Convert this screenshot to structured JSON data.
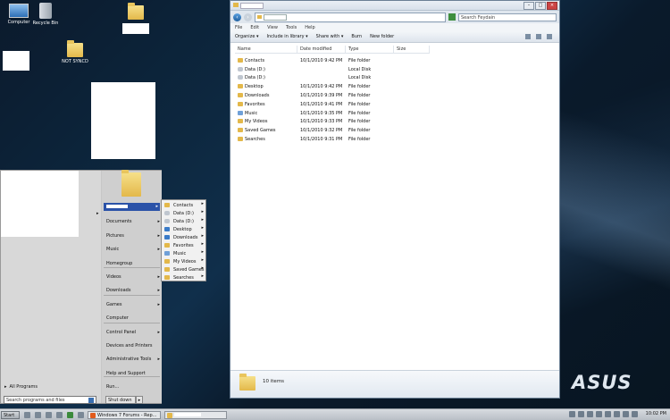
{
  "desktop": {
    "icons": [
      {
        "label": "Computer"
      },
      {
        "label": "Recycle Bin"
      },
      {
        "label": "NOT SYNCD"
      }
    ]
  },
  "explorer": {
    "search_placeholder": "Search Feydain",
    "menu": [
      "File",
      "Edit",
      "View",
      "Tools",
      "Help"
    ],
    "commands": [
      "Organize",
      "Include in library",
      "Share with",
      "Burn",
      "New folder"
    ],
    "columns": [
      "Name",
      "Date modified",
      "Type",
      "Size"
    ],
    "rows": [
      {
        "name": "Contacts",
        "date": "10/1/2010 9:42 PM",
        "type": "File folder",
        "icon": "folder"
      },
      {
        "name": "Data (D:)",
        "date": "",
        "type": "Local Disk",
        "icon": "disk"
      },
      {
        "name": "Data (D:)",
        "date": "",
        "type": "Local Disk",
        "icon": "disk"
      },
      {
        "name": "Desktop",
        "date": "10/1/2010 9:42 PM",
        "type": "File folder",
        "icon": "folder"
      },
      {
        "name": "Downloads",
        "date": "10/1/2010 9:39 PM",
        "type": "File folder",
        "icon": "folder"
      },
      {
        "name": "Favorites",
        "date": "10/1/2010 9:41 PM",
        "type": "File folder",
        "icon": "folder"
      },
      {
        "name": "Music",
        "date": "10/1/2010 9:35 PM",
        "type": "File folder",
        "icon": "music"
      },
      {
        "name": "My Videos",
        "date": "10/1/2010 9:33 PM",
        "type": "File folder",
        "icon": "folder"
      },
      {
        "name": "Saved Games",
        "date": "10/1/2010 9:32 PM",
        "type": "File folder",
        "icon": "folder"
      },
      {
        "name": "Searches",
        "date": "10/1/2010 9:31 PM",
        "type": "File folder",
        "icon": "folder"
      }
    ],
    "status": "10 items"
  },
  "start_menu": {
    "all_programs": "All Programs",
    "search_placeholder": "Search programs and files",
    "right_items": [
      {
        "label": "Documents",
        "arrow": true
      },
      {
        "label": "Pictures",
        "arrow": true
      },
      {
        "label": "Music",
        "arrow": true
      },
      {
        "label": "Homegroup",
        "arrow": false
      },
      {
        "label": "Videos",
        "arrow": true
      },
      {
        "label": "Downloads",
        "arrow": true
      },
      {
        "label": "Games",
        "arrow": true
      },
      {
        "label": "Computer",
        "arrow": false
      },
      {
        "label": "Control Panel",
        "arrow": true
      },
      {
        "label": "Devices and Printers",
        "arrow": false
      },
      {
        "label": "Administrative Tools",
        "arrow": true
      },
      {
        "label": "Help and Support",
        "arrow": false
      },
      {
        "label": "Run...",
        "arrow": false
      }
    ],
    "shutdown": "Shut down"
  },
  "submenu": {
    "items": [
      {
        "label": "Contacts",
        "icon": "folder"
      },
      {
        "label": "Data (D:)",
        "icon": "disk"
      },
      {
        "label": "Data (D:)",
        "icon": "disk"
      },
      {
        "label": "Desktop",
        "icon": "blue"
      },
      {
        "label": "Downloads",
        "icon": "blue"
      },
      {
        "label": "Favorites",
        "icon": "folder"
      },
      {
        "label": "Music",
        "icon": "music"
      },
      {
        "label": "My Videos",
        "icon": "folder"
      },
      {
        "label": "Saved Games",
        "icon": "folder"
      },
      {
        "label": "Searches",
        "icon": "folder"
      }
    ]
  },
  "taskbar": {
    "start": "Start",
    "task_browser": "Windows 7 Forums - Rep...",
    "clock": "10:02 PM"
  },
  "brand": "ASUS"
}
